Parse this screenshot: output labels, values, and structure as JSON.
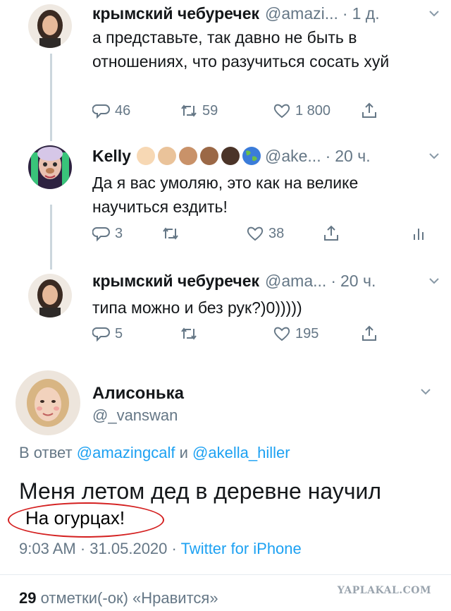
{
  "tweets": [
    {
      "name": "крымский чебуречек",
      "handle": "@amazi...",
      "time": "1 д.",
      "text": "а представьте, так давно не быть в отношениях, что разучиться сосать хуй",
      "replies": "46",
      "retweets": "59",
      "likes": "1 800"
    },
    {
      "name": "Kelly",
      "handle": "@ake...",
      "time": "20 ч.",
      "text": "Да я вас умоляю, это как на велике научиться ездить!",
      "replies": "3",
      "retweets": "",
      "likes": "38"
    },
    {
      "name": "крымский чебуречек",
      "handle": "@ama...",
      "time": "20 ч.",
      "text": "типа можно и без рук?)0)))))",
      "replies": "5",
      "retweets": "",
      "likes": "195"
    }
  ],
  "main": {
    "name": "Алисонька",
    "handle": "@_vanswan",
    "reply_prefix": "В ответ",
    "mention1": "@amazingcalf",
    "reply_and": "и",
    "mention2": "@akella_hiller",
    "text_line1": "Меня летом дед в деревне научил",
    "text_line2": "На огурцах!",
    "time": "9:03 AM",
    "date": "31.05.2020",
    "source": "Twitter for iPhone",
    "likes_count": "29",
    "likes_label": "отметки(-ок) «Нравится»"
  },
  "watermark": "YAPLAKAL.COM",
  "icons": [
    "reply-icon",
    "retweet-icon",
    "like-icon",
    "share-icon",
    "analytics-icon",
    "chevron-down-icon"
  ],
  "colors": {
    "link": "#1da1f2",
    "muted": "#657786",
    "thread": "#ccd6dd",
    "annotation": "#d42020"
  }
}
